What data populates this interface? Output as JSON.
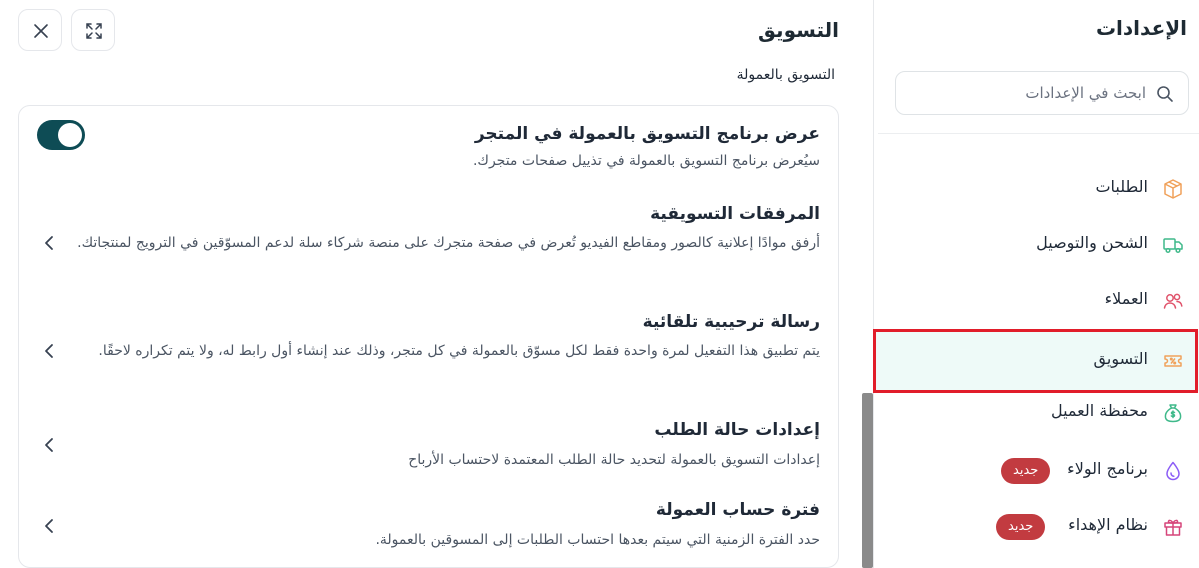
{
  "sidebar": {
    "title": "الإعدادات",
    "search": {
      "placeholder": "ابحث في الإعدادات",
      "value": ""
    },
    "items": [
      {
        "label": "الطلبات",
        "icon": "package-icon",
        "color": "#f0a15a"
      },
      {
        "label": "الشحن والتوصيل",
        "icon": "truck-icon",
        "color": "#3fb98a"
      },
      {
        "label": "العملاء",
        "icon": "users-icon",
        "color": "#e0536b"
      },
      {
        "label": "التسويق",
        "icon": "ticket-icon",
        "color": "#f0a15a",
        "active": true
      },
      {
        "label": "محفظة العميل",
        "icon": "money-bag-icon",
        "color": "#3fb98a"
      },
      {
        "label": "برنامج الولاء",
        "icon": "drop-icon",
        "color": "#8b5cf6",
        "badge": "جديد"
      },
      {
        "label": "نظام الإهداء",
        "icon": "gift-icon",
        "color": "#d6457a",
        "badge": "جديد"
      }
    ]
  },
  "main": {
    "title": "التسويق",
    "section_label": "التسويق بالعمولة",
    "rows": [
      {
        "title": "عرض برنامج التسويق بالعمولة في المتجر",
        "description": "سيُعرض برنامج التسويق بالعمولة في تذييل صفحات متجرك.",
        "control": "toggle",
        "toggle_on": true
      },
      {
        "title": "المرفقات التسويقية",
        "description": "أرفق موادًا إعلانية كالصور ومقاطع الفيديو تُعرض في صفحة متجرك على منصة شركاء سلة لدعم المسوّقين في الترويج لمنتجاتك.",
        "control": "chevron"
      },
      {
        "title": "رسالة ترحيبية تلقائية",
        "description": "يتم تطبيق هذا التفعيل لمرة واحدة فقط لكل مسوّق بالعمولة في كل متجر، وذلك عند إنشاء أول رابط له، ولا يتم تكراره لاحقًا.",
        "control": "chevron"
      },
      {
        "title": "إعدادات حالة الطلب",
        "description": "إعدادات التسويق بالعمولة لتحديد حالة الطلب المعتمدة لاحتساب الأرباح",
        "control": "chevron"
      },
      {
        "title": "فترة حساب العمولة",
        "description": "حدد الفترة الزمنية التي سيتم بعدها احتساب الطلبات إلى المسوقين بالعمولة.",
        "control": "chevron"
      }
    ]
  },
  "colors": {
    "accent": "#0e4c55",
    "active_bg": "#eefaf8",
    "badge": "#c23b40",
    "highlight": "#e11d2a"
  }
}
